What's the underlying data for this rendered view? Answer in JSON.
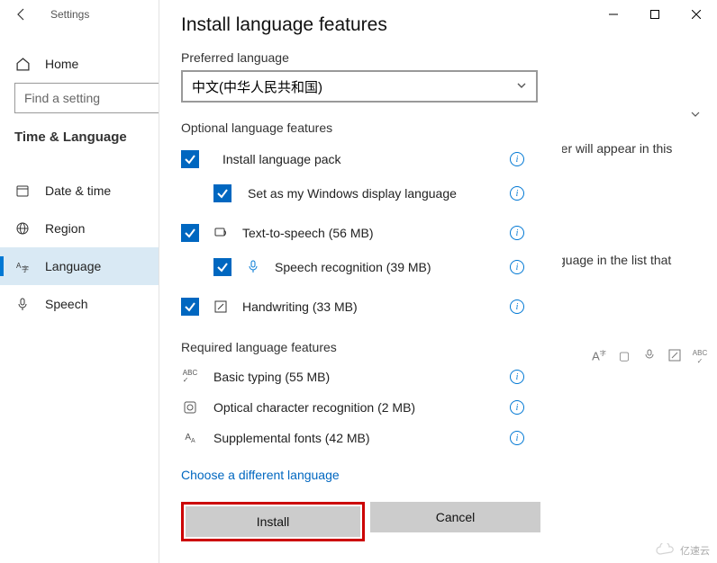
{
  "titlebar": {
    "app_name": "Settings"
  },
  "sidebar": {
    "home_label": "Home",
    "search_placeholder": "Find a setting",
    "section": "Time & Language",
    "items": [
      {
        "label": "Date & time"
      },
      {
        "label": "Region"
      },
      {
        "label": "Language"
      },
      {
        "label": "Speech"
      }
    ]
  },
  "peek": {
    "line1": "rer will appear in this",
    "line2": "guage in the list that"
  },
  "dialog": {
    "title": "Install language features",
    "preferred_label": "Preferred language",
    "dropdown_value": "中文(中华人民共和国)",
    "optional_header": "Optional language features",
    "options": [
      {
        "label": "Install language pack"
      },
      {
        "label": "Set as my Windows display language"
      },
      {
        "label": "Text-to-speech (56 MB)"
      },
      {
        "label": "Speech recognition (39 MB)"
      },
      {
        "label": "Handwriting (33 MB)"
      }
    ],
    "required_header": "Required language features",
    "required": [
      {
        "label": "Basic typing (55 MB)"
      },
      {
        "label": "Optical character recognition (2 MB)"
      },
      {
        "label": "Supplemental fonts (42 MB)"
      }
    ],
    "choose_different": "Choose a different language",
    "install_btn": "Install",
    "cancel_btn": "Cancel"
  },
  "watermark": "亿速云"
}
